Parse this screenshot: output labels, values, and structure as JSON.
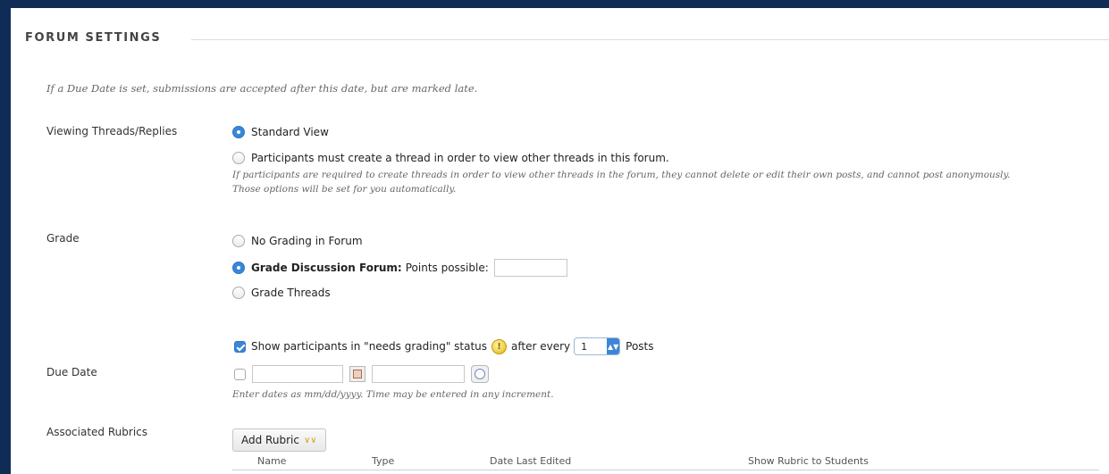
{
  "section": {
    "title": "FORUM SETTINGS"
  },
  "intro_note": "If a Due Date is set, submissions are accepted after this date, but are marked late.",
  "viewing": {
    "label": "Viewing Threads/Replies",
    "options": [
      {
        "label": "Standard View",
        "selected": true
      },
      {
        "label": "Participants must create a thread in order to view other threads in this forum.",
        "selected": false
      }
    ],
    "note_line1": "If participants are required to create threads in order to view other threads in the forum, they cannot delete or edit their own posts, and cannot post anonymously.",
    "note_line2": "Those options will be set for you automatically."
  },
  "grade": {
    "label": "Grade",
    "options": [
      {
        "label": "No Grading in Forum",
        "selected": false
      },
      {
        "label_bold": "Grade Discussion Forum:",
        "label_rest": "Points possible:",
        "selected": true,
        "points_value": ""
      },
      {
        "label": "Grade Threads",
        "selected": false
      }
    ],
    "needs_grading": {
      "checked": true,
      "text_before": "Show participants in \"needs grading\" status",
      "text_after": "after every",
      "posts_value": "1",
      "posts_label": "Posts"
    }
  },
  "due_date": {
    "label": "Due Date",
    "enabled": false,
    "date_value": "",
    "time_value": "",
    "hint": "Enter dates as mm/dd/yyyy. Time may be entered in any increment."
  },
  "rubrics": {
    "label": "Associated Rubrics",
    "add_button": "Add Rubric",
    "columns": [
      "Name",
      "Type",
      "Date Last Edited",
      "Show Rubric to Students"
    ]
  },
  "colors": {
    "frame": "#0f2c57",
    "accent": "#3b86d6",
    "warning": "#e2b70f"
  },
  "icons": [
    "calendar-icon",
    "clock-icon",
    "warning-icon",
    "chevron-down-icon"
  ]
}
